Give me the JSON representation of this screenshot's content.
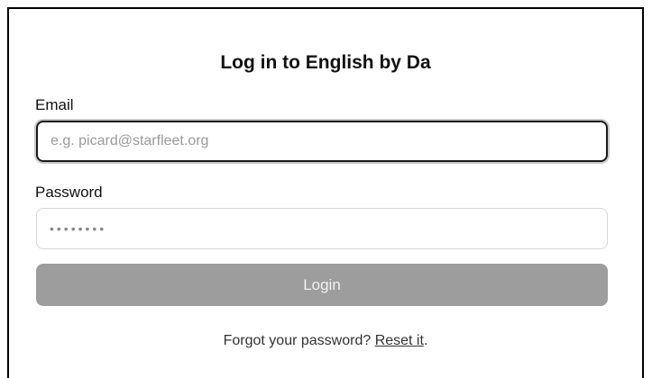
{
  "form": {
    "title": "Log in to English by Da",
    "email_label": "Email",
    "email_placeholder": "e.g. picard@starfleet.org",
    "email_value": "",
    "password_label": "Password",
    "password_value": "••••••••",
    "login_label": "Login",
    "forgot_text": "Forgot your password?",
    "reset_link": "Reset it",
    "forgot_suffix": "."
  },
  "colors": {
    "button_bg": "#9d9d9d",
    "focus_border": "#1a1a1a"
  }
}
